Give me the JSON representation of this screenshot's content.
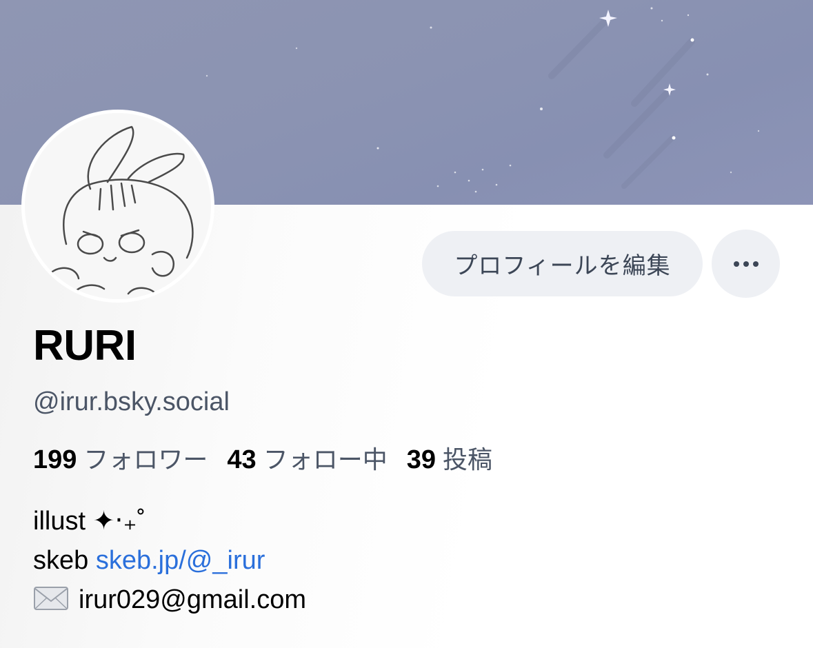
{
  "profile": {
    "display_name": "RURI",
    "handle": "@irur.bsky.social"
  },
  "actions": {
    "edit_label": "プロフィールを編集",
    "more_icon": "ellipsis-icon"
  },
  "stats": [
    {
      "count": "199",
      "label": "フォロワー"
    },
    {
      "count": "43",
      "label": "フォロー中"
    },
    {
      "count": "39",
      "label": "投稿"
    }
  ],
  "bio": {
    "line1": "illust ✦‧₊˚",
    "line2_prefix": "skeb",
    "line2_link": "skeb.jp/@_irur",
    "line3_icon": "envelope-icon",
    "line3_text": "irur029@gmail.com"
  },
  "colors": {
    "banner": "#8b93b2",
    "link": "#2a6fdb",
    "button_bg": "#eef0f4",
    "secondary_text": "#4b5566"
  }
}
